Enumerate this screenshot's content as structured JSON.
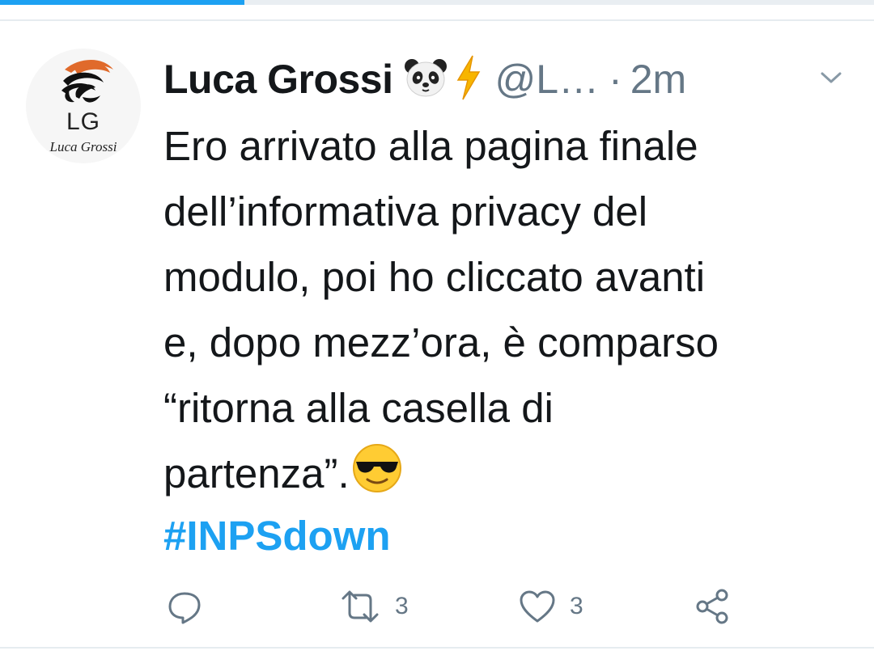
{
  "progress": {
    "fraction": 0.28,
    "color": "#1da1f2"
  },
  "tweet": {
    "avatar": {
      "initials": "LG",
      "name": "Luca Grossi"
    },
    "display_name": "Luca Grossi",
    "name_emojis": [
      "panda-icon",
      "lightning-icon"
    ],
    "handle": "@L…",
    "separator": "·",
    "time": "2m",
    "text_lines": [
      "Ero arrivato alla pagina finale",
      "dell’informativa privacy del",
      "modulo, poi ho cliccato avanti",
      "e, dopo mezz’ora, è comparso",
      "“ritorna alla casella di",
      "partenza”."
    ],
    "hashtag": "#INPSdown",
    "actions": {
      "reply": {
        "icon": "reply-icon"
      },
      "retweet": {
        "icon": "retweet-icon",
        "count": "3"
      },
      "like": {
        "icon": "heart-icon",
        "count": "3"
      },
      "share": {
        "icon": "share-icon"
      }
    }
  },
  "colors": {
    "text": "#14171a",
    "secondary": "#657786",
    "accent": "#1da1f2"
  }
}
